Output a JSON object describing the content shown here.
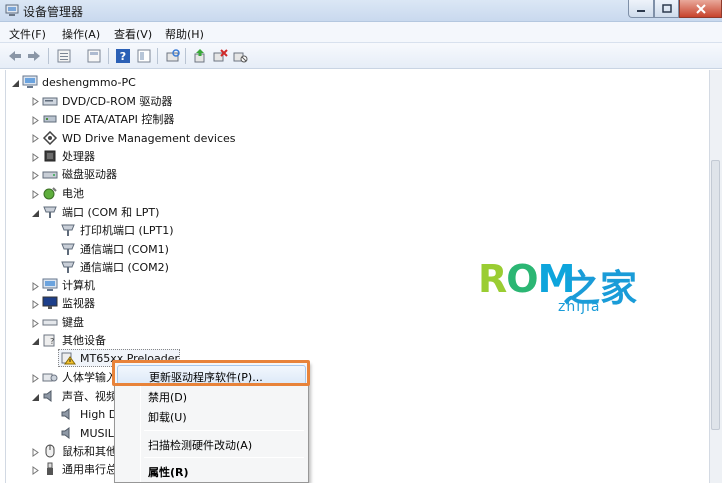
{
  "window": {
    "title": "设备管理器",
    "controls": {
      "minimize": "minimize-icon",
      "maximize": "maximize-icon",
      "close": "close-icon"
    }
  },
  "menu": [
    "文件(F)",
    "操作(A)",
    "查看(V)",
    "帮助(H)"
  ],
  "toolbar": [
    "back-icon",
    "forward-icon",
    "properties-icon",
    "device-list-icon",
    "help-icon",
    "view-icon",
    "scan-icon",
    "update-driver-icon",
    "uninstall-icon",
    "disable-icon"
  ],
  "tree": {
    "root": "deshengmmo-PC",
    "items": [
      {
        "label": "DVD/CD-ROM 驱动器",
        "icon": "dvd-drive-icon"
      },
      {
        "label": "IDE ATA/ATAPI 控制器",
        "icon": "ide-controller-icon"
      },
      {
        "label": "WD Drive Management devices",
        "icon": "wd-device-icon"
      },
      {
        "label": "处理器",
        "icon": "processor-icon"
      },
      {
        "label": "磁盘驱动器",
        "icon": "disk-drive-icon"
      },
      {
        "label": "电池",
        "icon": "battery-icon"
      },
      {
        "label": "端口 (COM 和 LPT)",
        "icon": "port-icon",
        "expanded": true,
        "children": [
          {
            "label": "打印机端口 (LPT1)",
            "icon": "port-icon"
          },
          {
            "label": "通信端口 (COM1)",
            "icon": "port-icon"
          },
          {
            "label": "通信端口 (COM2)",
            "icon": "port-icon"
          }
        ]
      },
      {
        "label": "计算机",
        "icon": "computer-icon"
      },
      {
        "label": "监视器",
        "icon": "monitor-icon"
      },
      {
        "label": "键盘",
        "icon": "keyboard-icon"
      },
      {
        "label": "其他设备",
        "icon": "other-devices-icon",
        "expanded": true,
        "children": [
          {
            "label": "MT65xx Preloader",
            "icon": "unknown-device-warning-icon",
            "selected": true
          }
        ]
      },
      {
        "label": "人体学输入",
        "icon": "hid-icon"
      },
      {
        "label": "声音、视频",
        "icon": "audio-icon",
        "expanded": true,
        "children": [
          {
            "label": "High D",
            "icon": "speaker-icon"
          },
          {
            "label": "MUSIL",
            "icon": "speaker-icon"
          }
        ]
      },
      {
        "label": "鼠标和其他",
        "icon": "mouse-icon"
      },
      {
        "label": "通用串行总",
        "icon": "usb-icon"
      }
    ]
  },
  "context_menu": {
    "items": [
      {
        "label": "更新驱动程序软件(P)...",
        "highlighted": true
      },
      {
        "label": "禁用(D)"
      },
      {
        "label": "卸载(U)"
      },
      {
        "separator": true
      },
      {
        "label": "扫描检测硬件改动(A)"
      },
      {
        "separator": true
      },
      {
        "label": "属性(R)",
        "bold": true
      }
    ]
  },
  "watermark": {
    "brand_r": "R",
    "brand_o": "O",
    "brand_m": "M",
    "cn": "之家",
    "sub": "zhijia"
  },
  "colors": {
    "highlight_border": "#e8833a",
    "title_bar": "#dbe7f5",
    "watermark_blue": "#1a9cd8"
  }
}
